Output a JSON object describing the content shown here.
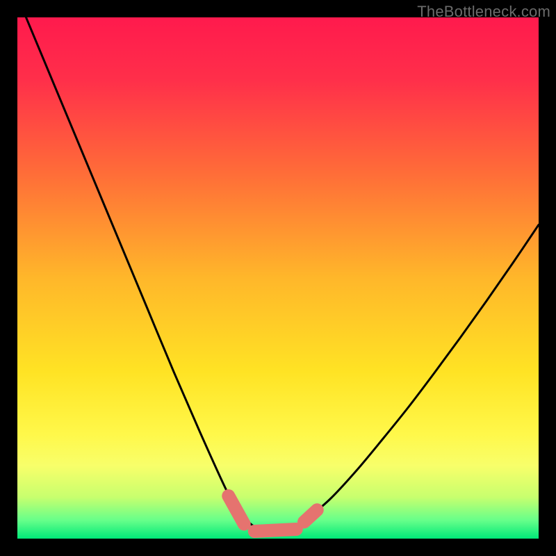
{
  "attribution": "TheBottleneck.com",
  "chart_data": {
    "type": "line",
    "title": "",
    "xlabel": "",
    "ylabel": "",
    "xlim": [
      0,
      100
    ],
    "ylim": [
      0,
      100
    ],
    "grid": false,
    "legend": false,
    "series": [
      {
        "name": "bottleneck-curve",
        "x": [
          0,
          5,
          10,
          15,
          20,
          25,
          30,
          35,
          40,
          42,
          44,
          46,
          48,
          50,
          52,
          54,
          55,
          60,
          65,
          70,
          75,
          80,
          85,
          90,
          95,
          100
        ],
        "y": [
          104,
          92,
          80,
          68,
          56,
          44,
          32,
          20.5,
          9.5,
          6,
          3.5,
          2,
          1.4,
          1.3,
          1.6,
          2.6,
          3.3,
          7.6,
          13,
          19,
          25.2,
          31.8,
          38.6,
          45.6,
          52.8,
          60.2
        ]
      },
      {
        "name": "marker-segments",
        "note": "pink marker dashes near curve minimum",
        "segments": [
          {
            "x": [
              40.5,
              43.5
            ],
            "y": [
              8.2,
              2.8
            ]
          },
          {
            "x": [
              45.5,
              53.5
            ],
            "y": [
              1.4,
              1.8
            ]
          },
          {
            "x": [
              55.0,
              57.5
            ],
            "y": [
              3.2,
              5.5
            ]
          }
        ]
      }
    ],
    "gradient_stops": [
      {
        "offset": 0.0,
        "color": "#ff1a4d"
      },
      {
        "offset": 0.12,
        "color": "#ff2f4a"
      },
      {
        "offset": 0.3,
        "color": "#ff6d38"
      },
      {
        "offset": 0.5,
        "color": "#ffb72a"
      },
      {
        "offset": 0.68,
        "color": "#ffe324"
      },
      {
        "offset": 0.8,
        "color": "#fff84a"
      },
      {
        "offset": 0.86,
        "color": "#f8ff6a"
      },
      {
        "offset": 0.92,
        "color": "#c8ff6e"
      },
      {
        "offset": 0.965,
        "color": "#66ff8a"
      },
      {
        "offset": 1.0,
        "color": "#00e878"
      }
    ]
  }
}
